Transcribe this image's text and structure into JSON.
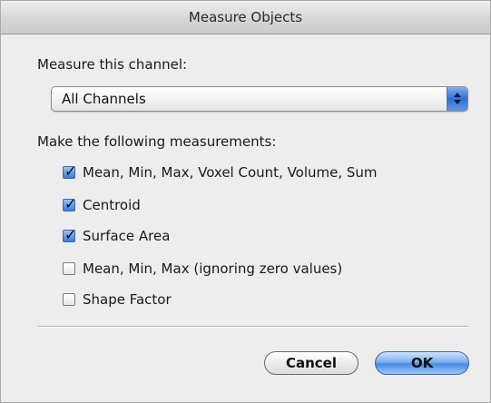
{
  "window": {
    "title": "Measure Objects"
  },
  "channel": {
    "label": "Measure this channel:",
    "selected": "All Channels"
  },
  "measurements": {
    "label": "Make the following measurements:",
    "items": [
      {
        "label": "Mean, Min, Max, Voxel Count, Volume, Sum",
        "checked": true
      },
      {
        "label": "Centroid",
        "checked": true
      },
      {
        "label": "Surface Area",
        "checked": true
      },
      {
        "label": "Mean, Min, Max (ignoring zero values)",
        "checked": false
      },
      {
        "label": "Shape Factor",
        "checked": false
      }
    ]
  },
  "buttons": {
    "cancel_label": "Cancel",
    "ok_label": "OK"
  },
  "colors": {
    "accent": "#3a7ad9",
    "dialog_background": "#ededed"
  },
  "icons": {
    "popup": "updown-arrows-icon",
    "checkbox": "checkmark-icon"
  }
}
